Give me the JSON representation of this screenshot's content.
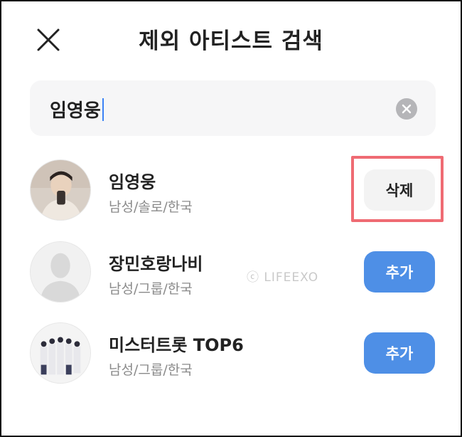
{
  "header": {
    "title": "제외 아티스트 검색",
    "close_icon": "close-icon"
  },
  "search": {
    "value": "임영웅",
    "clear_icon": "clear-icon"
  },
  "artists": [
    {
      "name": "임영웅",
      "meta": "남성/솔로/한국",
      "action": "삭제"
    },
    {
      "name": "장민호랑나비",
      "meta": "남성/그룹/한국",
      "action": "추가"
    },
    {
      "name": "미스터트롯 TOP6",
      "meta": "남성/그룹/한국",
      "action": "추가"
    }
  ],
  "watermark": "ⓒ LIFEEXO",
  "colors": {
    "add_button": "#4e8fe6",
    "delete_button": "#f3f3f3",
    "highlight": "#ef6b73",
    "caret": "#3b82f6"
  }
}
